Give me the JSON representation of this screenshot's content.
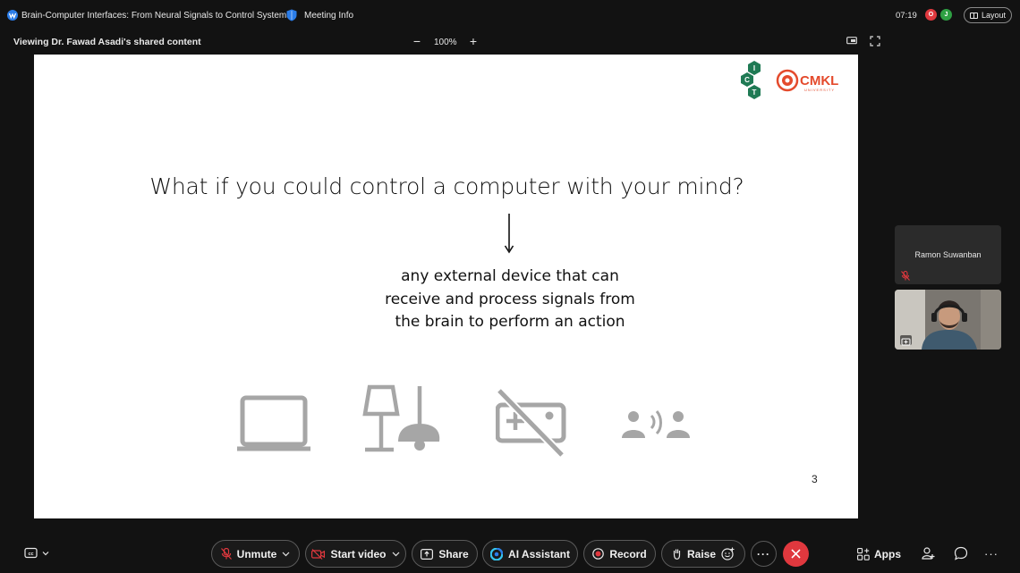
{
  "titlebar": {
    "meeting_title": "Brain-Computer Interfaces: From Neural Signals to Control Systems",
    "meeting_info_label": "Meeting Info",
    "clock": "07:19",
    "status_a": "O",
    "status_b": "J",
    "layout_label": "Layout"
  },
  "share_header": {
    "viewing_label": "Viewing Dr. Fawad Asadi's shared content",
    "zoom_out": "−",
    "zoom_level": "100%",
    "zoom_in": "+"
  },
  "slide": {
    "question": "What if you could control a computer with your mind?",
    "description_lines": [
      "any external device that can",
      "receive and process signals from",
      "the brain to perform an action"
    ],
    "page_number": "3",
    "icons": [
      "laptop-icon",
      "lamp-icon",
      "gaming-disabled-icon",
      "speech-people-icon"
    ]
  },
  "participants": [
    {
      "name": "Ramon Suwanban",
      "muted": true,
      "video": false
    },
    {
      "name": "",
      "muted": false,
      "video": true
    }
  ],
  "toolbar": {
    "unmute_label": "Unmute",
    "start_video_label": "Start video",
    "share_label": "Share",
    "ai_label": "AI Assistant",
    "record_label": "Record",
    "raise_label": "Raise",
    "more_label": "···",
    "apps_label": "Apps",
    "more_right_label": "···"
  },
  "colors": {
    "background": "#121212",
    "leave_red": "#e0383e",
    "muted_red": "#e0383e",
    "ict_green": "#1f7a54",
    "cmkl_red": "#e44a2c",
    "slide_icon_gray": "#a6a6a6"
  }
}
